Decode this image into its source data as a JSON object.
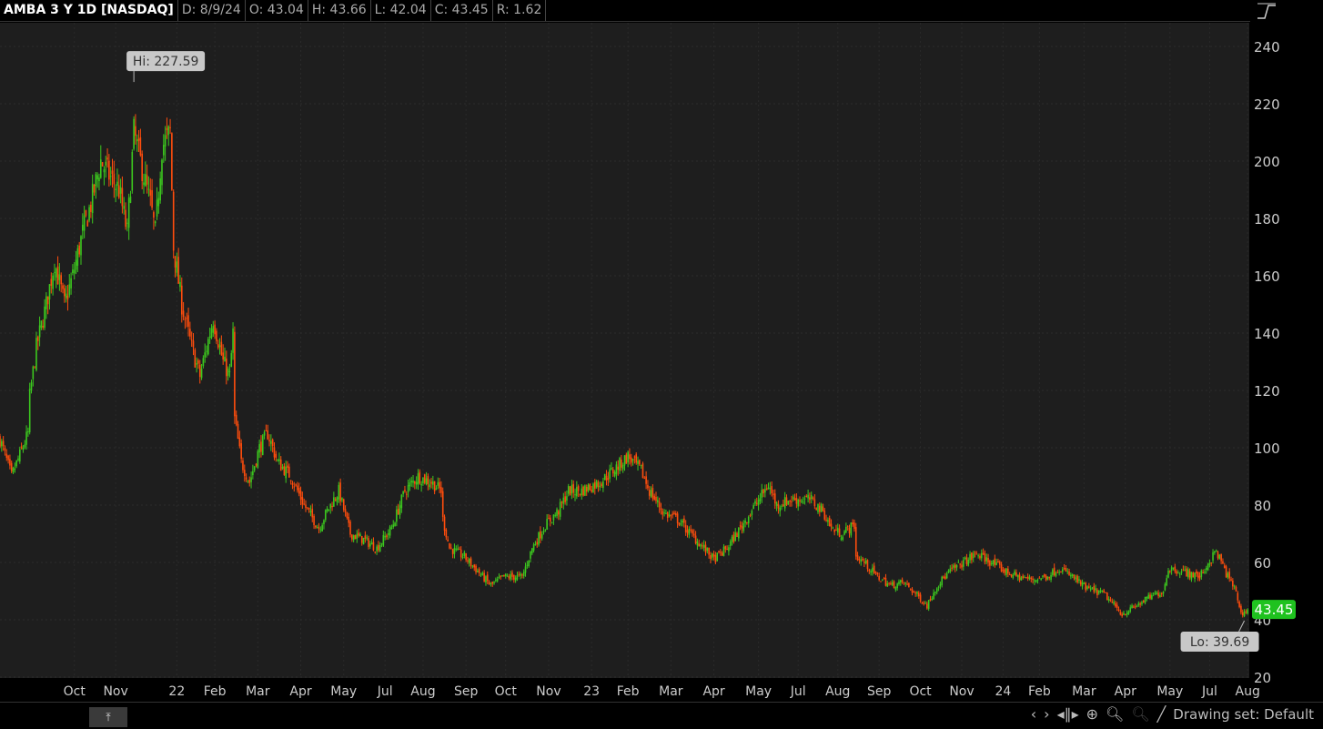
{
  "header": {
    "symbol": "AMBA 3 Y 1D [NASDAQ]",
    "date": "D: 8/9/24",
    "open": "O: 43.04",
    "high": "H: 43.66",
    "low": "L: 42.04",
    "close": "C: 43.45",
    "range": "R: 1.62"
  },
  "toolbar": {
    "drawing_set": "Drawing set: Default",
    "icons": [
      "scroll-left-icon",
      "scroll-right-icon",
      "expand-icon",
      "crosshair-icon",
      "zoom-in-icon",
      "zoom-out-icon",
      "drawing-line-icon"
    ]
  },
  "colors": {
    "up": "#3cc81e",
    "down": "#ff4d0d",
    "last_price_bg": "#1fc21f",
    "bg": "#1e1e1e"
  },
  "chart_data": {
    "type": "candlestick",
    "title": "AMBA 3 Y 1D [NASDAQ]",
    "total_days": 756,
    "ylim": [
      20,
      245
    ],
    "yticks": [
      20,
      40,
      60,
      80,
      100,
      120,
      140,
      160,
      180,
      200,
      220,
      240
    ],
    "xticks": [
      {
        "d": 45,
        "l": "Oct"
      },
      {
        "d": 70,
        "l": "Nov"
      },
      {
        "d": 107,
        "l": "22"
      },
      {
        "d": 130,
        "l": "Feb"
      },
      {
        "d": 156,
        "l": "Mar"
      },
      {
        "d": 182,
        "l": "Apr"
      },
      {
        "d": 208,
        "l": "May"
      },
      {
        "d": 233,
        "l": "Jul"
      },
      {
        "d": 256,
        "l": "Aug"
      },
      {
        "d": 282,
        "l": "Sep"
      },
      {
        "d": 306,
        "l": "Oct"
      },
      {
        "d": 332,
        "l": "Nov"
      },
      {
        "d": 358,
        "l": "23"
      },
      {
        "d": 380,
        "l": "Feb"
      },
      {
        "d": 406,
        "l": "Mar"
      },
      {
        "d": 432,
        "l": "Apr"
      },
      {
        "d": 459,
        "l": "May"
      },
      {
        "d": 483,
        "l": "Jul"
      },
      {
        "d": 507,
        "l": "Aug"
      },
      {
        "d": 532,
        "l": "Sep"
      },
      {
        "d": 557,
        "l": "Oct"
      },
      {
        "d": 582,
        "l": "Nov"
      },
      {
        "d": 607,
        "l": "24"
      },
      {
        "d": 629,
        "l": "Feb"
      },
      {
        "d": 656,
        "l": "Mar"
      },
      {
        "d": 681,
        "l": "Apr"
      },
      {
        "d": 708,
        "l": "May"
      },
      {
        "d": 732,
        "l": "Jul"
      },
      {
        "d": 755,
        "l": "Aug"
      }
    ],
    "approx_closes": [
      [
        0,
        103
      ],
      [
        7,
        90
      ],
      [
        17,
        105
      ],
      [
        18,
        118
      ],
      [
        22,
        135
      ],
      [
        28,
        150
      ],
      [
        33,
        165
      ],
      [
        39,
        150
      ],
      [
        44,
        160
      ],
      [
        50,
        175
      ],
      [
        55,
        185
      ],
      [
        61,
        200
      ],
      [
        66,
        195
      ],
      [
        72,
        190
      ],
      [
        77,
        175
      ],
      [
        81,
        210
      ],
      [
        85,
        200
      ],
      [
        91,
        185
      ],
      [
        94,
        175
      ],
      [
        98,
        205
      ],
      [
        103,
        210
      ],
      [
        105,
        170
      ],
      [
        110,
        150
      ],
      [
        116,
        135
      ],
      [
        121,
        125
      ],
      [
        129,
        145
      ],
      [
        135,
        130
      ],
      [
        139,
        125
      ],
      [
        141,
        140
      ],
      [
        142,
        110
      ],
      [
        146,
        95
      ],
      [
        151,
        88
      ],
      [
        157,
        100
      ],
      [
        162,
        105
      ],
      [
        168,
        95
      ],
      [
        176,
        90
      ],
      [
        184,
        80
      ],
      [
        193,
        72
      ],
      [
        198,
        78
      ],
      [
        205,
        85
      ],
      [
        212,
        70
      ],
      [
        220,
        68
      ],
      [
        228,
        65
      ],
      [
        237,
        72
      ],
      [
        245,
        85
      ],
      [
        253,
        90
      ],
      [
        261,
        88
      ],
      [
        267,
        85
      ],
      [
        268,
        75
      ],
      [
        272,
        65
      ],
      [
        281,
        62
      ],
      [
        289,
        57
      ],
      [
        297,
        52
      ],
      [
        305,
        55
      ],
      [
        316,
        55
      ],
      [
        322,
        65
      ],
      [
        330,
        73
      ],
      [
        338,
        78
      ],
      [
        344,
        85
      ],
      [
        352,
        85
      ],
      [
        363,
        88
      ],
      [
        371,
        92
      ],
      [
        380,
        97
      ],
      [
        388,
        92
      ],
      [
        393,
        85
      ],
      [
        402,
        77
      ],
      [
        410,
        75
      ],
      [
        418,
        70
      ],
      [
        426,
        65
      ],
      [
        432,
        61
      ],
      [
        440,
        65
      ],
      [
        448,
        72
      ],
      [
        457,
        80
      ],
      [
        465,
        87
      ],
      [
        470,
        80
      ],
      [
        479,
        82
      ],
      [
        490,
        82
      ],
      [
        498,
        78
      ],
      [
        503,
        72
      ],
      [
        509,
        70
      ],
      [
        517,
        73
      ],
      [
        518,
        62
      ],
      [
        523,
        60
      ],
      [
        531,
        55
      ],
      [
        539,
        52
      ],
      [
        547,
        53
      ],
      [
        556,
        48
      ],
      [
        561,
        45
      ],
      [
        567,
        52
      ],
      [
        575,
        57
      ],
      [
        583,
        60
      ],
      [
        591,
        63
      ],
      [
        600,
        60
      ],
      [
        608,
        57
      ],
      [
        616,
        55
      ],
      [
        624,
        54
      ],
      [
        633,
        55
      ],
      [
        641,
        58
      ],
      [
        649,
        55
      ],
      [
        657,
        51
      ],
      [
        668,
        49
      ],
      [
        679,
        42
      ],
      [
        688,
        45
      ],
      [
        696,
        48
      ],
      [
        704,
        50
      ],
      [
        707,
        58
      ],
      [
        715,
        57
      ],
      [
        726,
        55
      ],
      [
        736,
        64
      ],
      [
        743,
        55
      ],
      [
        748,
        50
      ],
      [
        751,
        42
      ],
      [
        755,
        43.45
      ]
    ],
    "annotations": {
      "high": {
        "d": 81,
        "value": 227.59,
        "label": "Hi: 227.59"
      },
      "low": {
        "d": 753,
        "value": 39.69,
        "label": "Lo: 39.69"
      },
      "last": {
        "value": 43.45,
        "label": "43.45"
      }
    }
  }
}
